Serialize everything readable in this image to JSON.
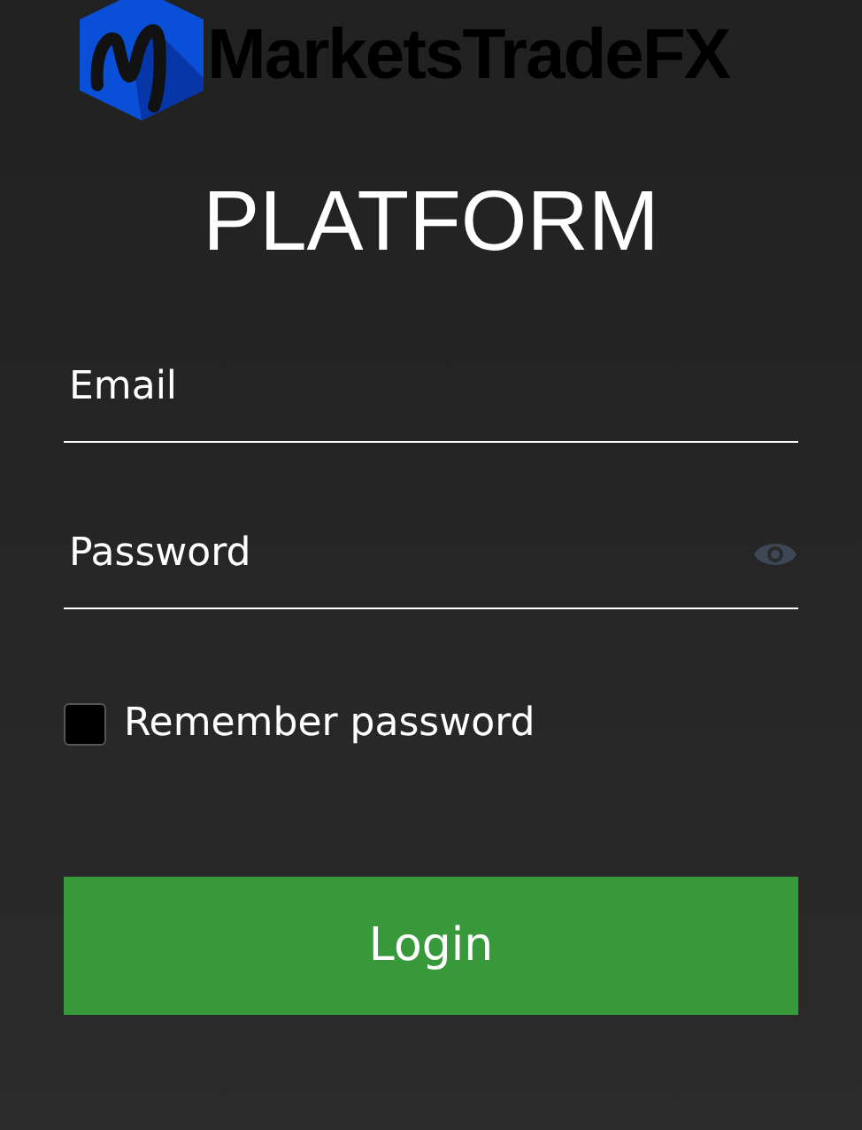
{
  "logo": {
    "text": "MarketsTradeFX"
  },
  "title": "PLATFORM",
  "email": {
    "placeholder": "Email"
  },
  "password": {
    "placeholder": "Password"
  },
  "remember": {
    "label": "Remember password",
    "checked": false
  },
  "login_button": "Login"
}
